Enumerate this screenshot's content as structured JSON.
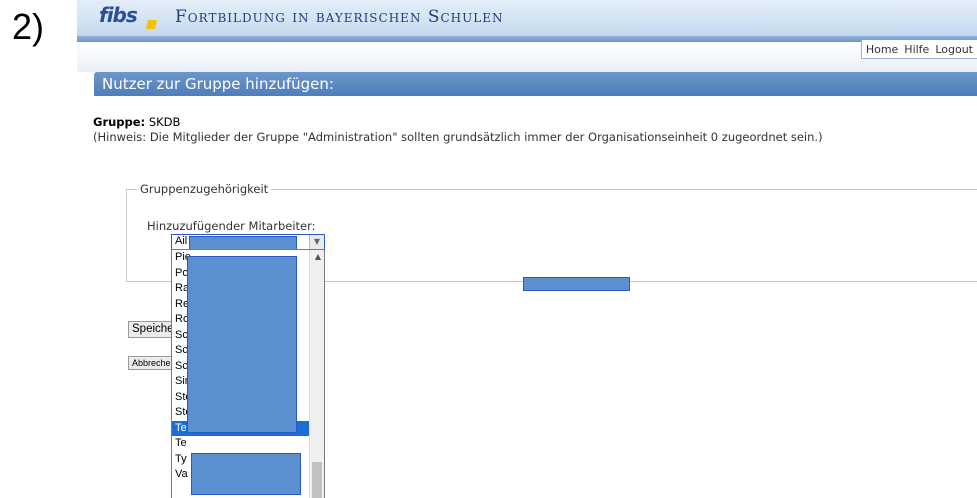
{
  "step_label": "2)",
  "banner": {
    "logo": "fibs",
    "title": "Fortbildung in bayerischen Schulen"
  },
  "topnav": {
    "home": "Home",
    "help": "Hilfe",
    "logout": "Logout"
  },
  "page": {
    "header": "Nutzer zur Gruppe hinzufügen:",
    "group_label": "Gruppe:",
    "group_value": "SKDB",
    "hint": "(Hinweis: Die Mitglieder der Gruppe \"Administration\" sollten grundsätzlich immer der Organisationseinheit 0 zugeordnet sein.)",
    "fieldset_legend": "Gruppenzugehörigkeit",
    "employee_label": "Hinzuzufügender Mitarbeiter:",
    "select_value": "Ail"
  },
  "dropdown": {
    "items": [
      "Pie",
      "Po",
      "Ra",
      "Re",
      "Ro",
      "Sc",
      "Sc",
      "Sc",
      "Sir",
      "Ste",
      "Ste",
      "Tester, Hermann",
      "Te",
      "Ty",
      "Va"
    ],
    "selected_index": 11
  },
  "buttons": {
    "save": "Speichern",
    "cancel": "Abbrechen"
  }
}
